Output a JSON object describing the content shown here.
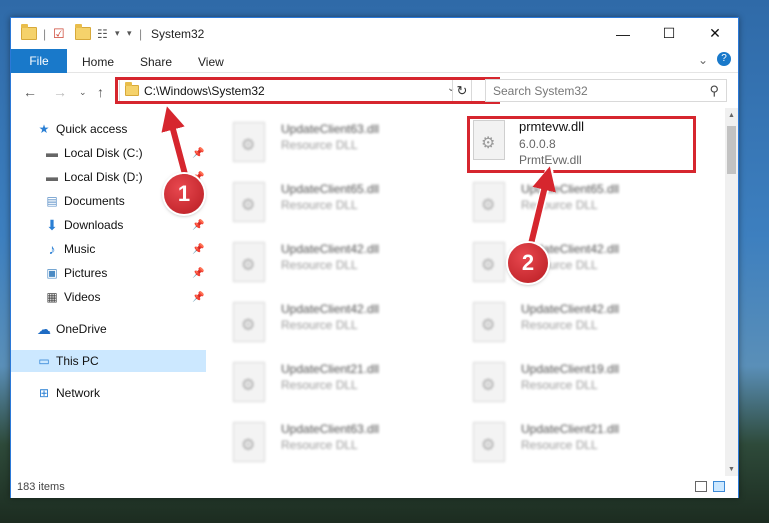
{
  "window": {
    "title": "System32",
    "ribbon_tabs": [
      "File",
      "Home",
      "Share",
      "View"
    ],
    "controls": {
      "minimize": "—",
      "maximize": "☐",
      "close": "✕",
      "help": "?",
      "expand": "⌄"
    }
  },
  "address_bar": {
    "path": "C:\\Windows\\System32",
    "search_placeholder": "Search System32"
  },
  "sidebar": {
    "items": [
      {
        "label": "Quick access",
        "icon": "star-icon"
      },
      {
        "label": "Local Disk (C:)",
        "icon": "drive-icon",
        "pinned": true
      },
      {
        "label": "Local Disk (D:)",
        "icon": "drive-icon",
        "pinned": true
      },
      {
        "label": "Documents",
        "icon": "documents-icon",
        "pinned": true
      },
      {
        "label": "Downloads",
        "icon": "download-icon",
        "pinned": true
      },
      {
        "label": "Music",
        "icon": "music-icon",
        "pinned": true
      },
      {
        "label": "Pictures",
        "icon": "pictures-icon",
        "pinned": true
      },
      {
        "label": "Videos",
        "icon": "videos-icon",
        "pinned": true
      },
      {
        "label": "OneDrive",
        "icon": "cloud-icon"
      },
      {
        "label": "This PC",
        "icon": "computer-icon",
        "selected": true
      },
      {
        "label": "Network",
        "icon": "network-icon"
      }
    ]
  },
  "files": [
    {
      "name": "UpdateClient63.dll",
      "desc": "Resource DLL"
    },
    {
      "name": "prmtevw.dll",
      "desc": "6.0.0.8",
      "desc2": "PrmtEvw.dll",
      "highlighted": true
    },
    {
      "name": "UpdateClient65.dll",
      "desc": "Resource DLL"
    },
    {
      "name": "UpdateClient65.dll",
      "desc": "Resource DLL"
    },
    {
      "name": "UpdateClient42.dll",
      "desc": "Resource DLL"
    },
    {
      "name": "UpdateClient42.dll",
      "desc": "Resource DLL"
    },
    {
      "name": "UpdateClient42.dll",
      "desc": "Resource DLL"
    },
    {
      "name": "UpdateClient42.dll",
      "desc": "Resource DLL"
    },
    {
      "name": "UpdateClient21.dll",
      "desc": "Resource DLL"
    },
    {
      "name": "UpdateClient19.dll",
      "desc": "Resource DLL"
    },
    {
      "name": "UpdateClient63.dll",
      "desc": "Resource DLL"
    },
    {
      "name": "UpdateClient21.dll",
      "desc": "Resource DLL"
    }
  ],
  "status": {
    "item_count": "183 items"
  },
  "callouts": {
    "one": "1",
    "two": "2"
  },
  "colors": {
    "accent": "#1979ca",
    "highlight": "#d6262e"
  }
}
